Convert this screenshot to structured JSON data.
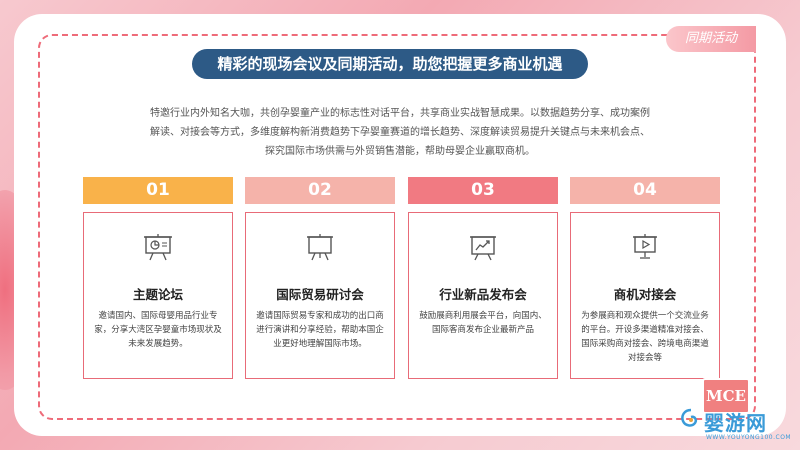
{
  "tag": "同期活动",
  "headline": "精彩的现场会议及同期活动，助您把握更多商业机遇",
  "intro": [
    "特邀行业内外知名大咖，共创孕婴童产业的标志性对话平台，共享商业实战智慧成果。以数据趋势分享、成功案例",
    "解读、对接会等方式，多维度解构新消费趋势下孕婴童赛道的增长趋势、深度解读贸易提升关键点与未来机会点、",
    "探究国际市场供需与外贸销售潜能，帮助母婴企业赢取商机。"
  ],
  "columns": [
    {
      "number": "01",
      "color": "#f9b24a",
      "icon": "presentation-chart-icon",
      "title": "主题论坛",
      "text": "邀请国内、国际母婴用品行业专家，分享大湾区孕婴童市场现状及未来发展趋势。"
    },
    {
      "number": "02",
      "color": "#f5b3aa",
      "icon": "presentation-board-icon",
      "title": "国际贸易研讨会",
      "text": "邀请国际贸易专家和成功的出口商进行演讲和分享经验，帮助本国企业更好地理解国际市场。"
    },
    {
      "number": "03",
      "color": "#f17a82",
      "icon": "growth-chart-icon",
      "title": "行业新品发布会",
      "text": "鼓励展商利用展会平台，向国内、国际客商发布企业最新产品"
    },
    {
      "number": "04",
      "color": "#f5b3aa",
      "icon": "video-screen-icon",
      "title": "商机对接会",
      "text": "为参展商和观众提供一个交流业务的平台。开设多渠道精准对接会、国际采购商对接会、跨境电商渠道对接会等"
    }
  ],
  "logo": "MCE",
  "watermark": {
    "name": "婴游网",
    "url": "WWW.YOUYONG100.COM"
  }
}
